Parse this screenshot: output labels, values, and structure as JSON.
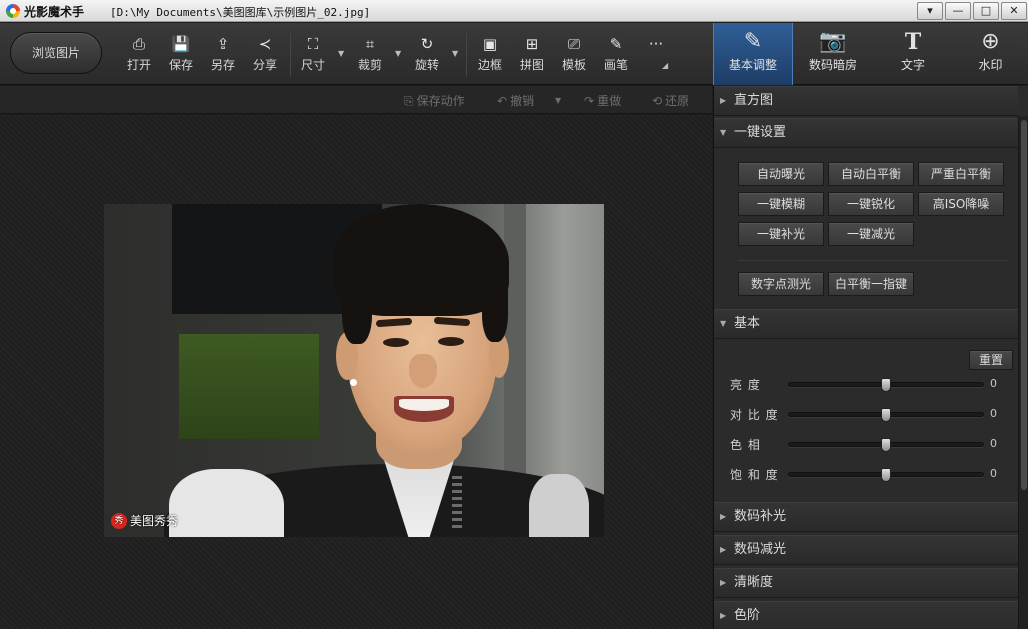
{
  "window": {
    "app_name": "光影魔术手",
    "file_path": "[D:\\My Documents\\美图图库\\示例图片_02.jpg]",
    "controls": [
      "▾",
      "—",
      "□",
      "✕"
    ]
  },
  "toolbar": {
    "browse_label": "浏览图片",
    "tools": [
      {
        "icon": "⎙",
        "label": "打开"
      },
      {
        "icon": "💾",
        "label": "保存"
      },
      {
        "icon": "⇪",
        "label": "另存"
      },
      {
        "icon": "≺",
        "label": "分享"
      },
      {
        "icon": "⛶",
        "label": "尺寸"
      },
      {
        "icon": "⌗",
        "label": "裁剪"
      },
      {
        "icon": "↻",
        "label": "旋转"
      },
      {
        "icon": "▣",
        "label": "边框"
      },
      {
        "icon": "⊞",
        "label": "拼图"
      },
      {
        "icon": "⎚",
        "label": "模板"
      },
      {
        "icon": "✎",
        "label": "画笔"
      },
      {
        "icon": "···",
        "label": ""
      }
    ],
    "panel_tabs": [
      {
        "icon": "✎",
        "label": "基本调整"
      },
      {
        "icon": "📷",
        "label": "数码暗房"
      },
      {
        "icon": "T",
        "label": "文字"
      },
      {
        "icon": "⊕",
        "label": "水印"
      }
    ]
  },
  "actions": {
    "save_action": "保存动作",
    "undo": "撤销",
    "redo": "重做",
    "restore": "还原"
  },
  "photo": {
    "watermark_badge": "秀",
    "watermark_text": "美图秀秀"
  },
  "panel": {
    "sections": {
      "histogram": "直方图",
      "one_click": "一键设置",
      "basic": "基本",
      "digital_fill": "数码补光",
      "digital_reduce": "数码减光",
      "clarity": "清晰度",
      "levels": "色阶"
    },
    "one_click_buttons": [
      "自动曝光",
      "自动白平衡",
      "严重白平衡",
      "一键模糊",
      "一键锐化",
      "高ISO降噪",
      "一键补光",
      "一键减光"
    ],
    "metering_buttons": [
      "数字点测光",
      "白平衡一指键"
    ],
    "reset_label": "重置",
    "sliders": [
      {
        "label": "亮    度",
        "value": 0,
        "min": -100,
        "max": 100
      },
      {
        "label": "对 比 度",
        "value": 0,
        "min": -100,
        "max": 100
      },
      {
        "label": "色    相",
        "value": 0,
        "min": -100,
        "max": 100
      },
      {
        "label": "饱 和 度",
        "value": 0,
        "min": -100,
        "max": 100
      }
    ]
  }
}
